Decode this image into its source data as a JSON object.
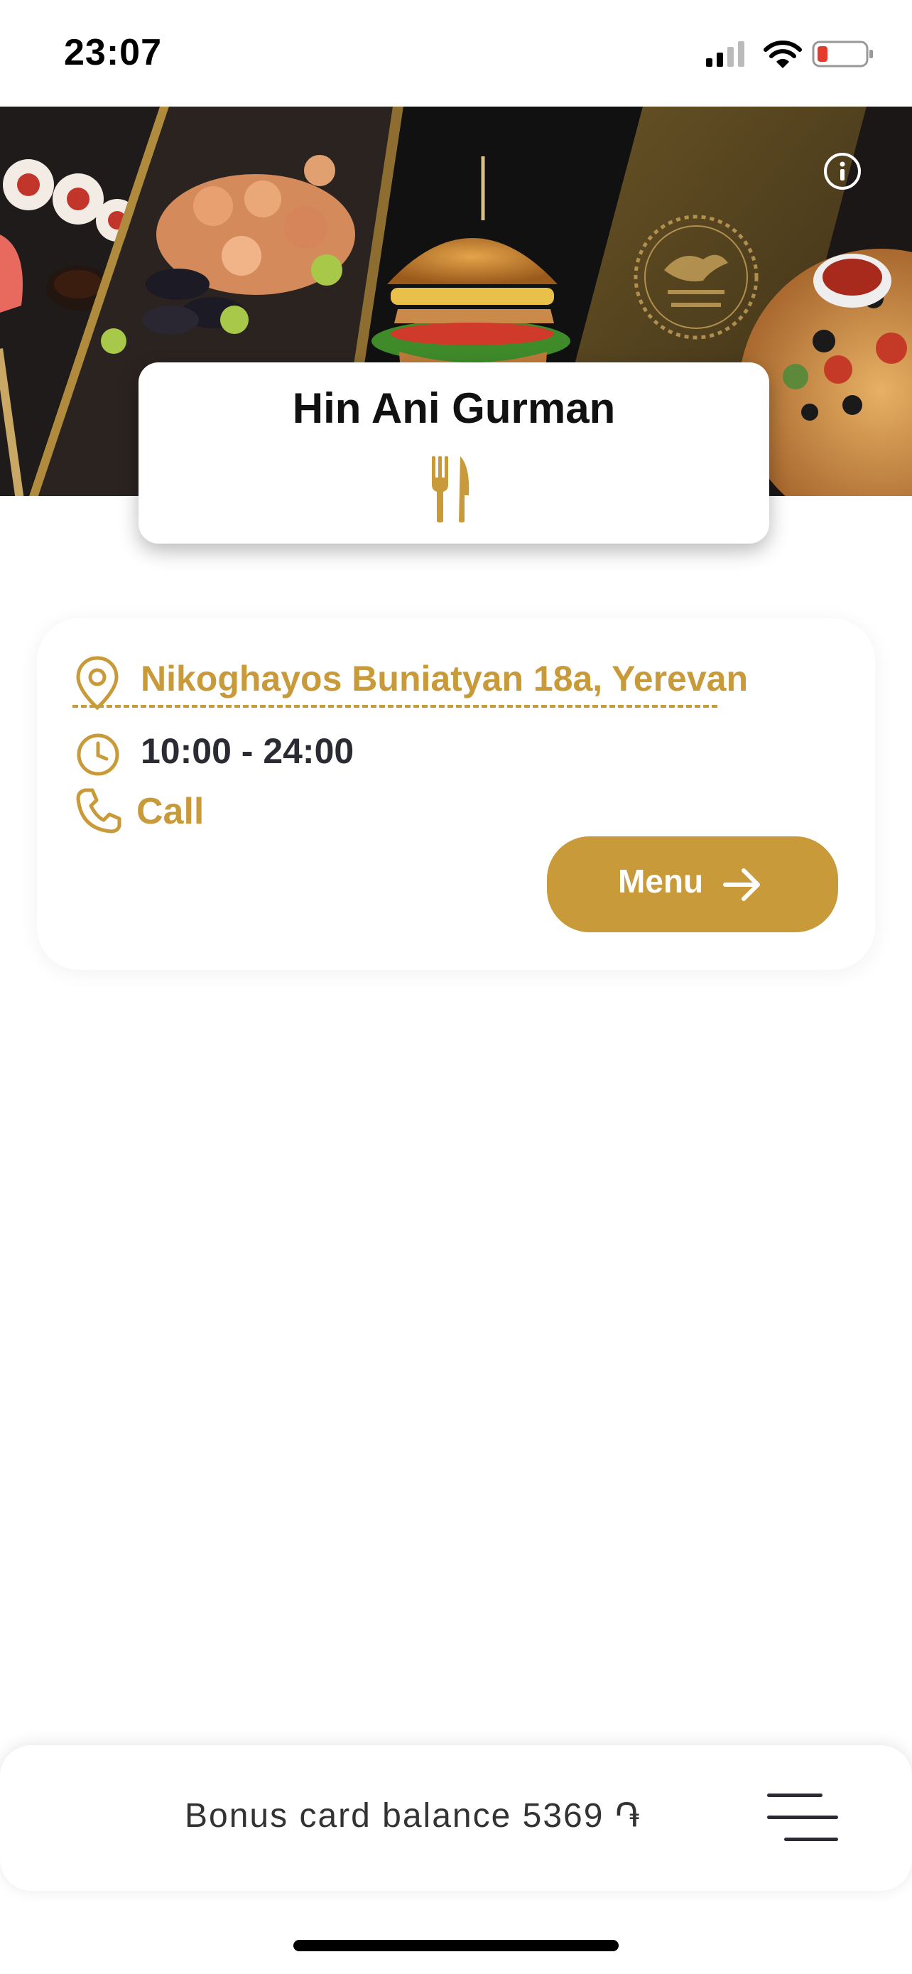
{
  "status_bar": {
    "time": "23:07",
    "icons": [
      "cellular-signal-icon",
      "wifi-icon",
      "battery-low-icon"
    ]
  },
  "hero": {
    "image_description_icon": "food-collage-image",
    "info_icon": "info-icon"
  },
  "restaurant": {
    "name": "Hin Ani Gurman",
    "category_icon": "cutlery-icon"
  },
  "details": {
    "address": "Nikoghayos Buniatyan 18a, Yerevan",
    "hours": "10:00 - 24:00",
    "call_label": "Call",
    "menu_label": "Menu"
  },
  "bottom_bar": {
    "bonus_text": "Bonus card balance 5369 ֏",
    "menu_icon": "hamburger-menu-icon"
  },
  "colors": {
    "accent": "#c99a3a",
    "text_dark": "#2b2b33",
    "background": "#ffffff"
  }
}
